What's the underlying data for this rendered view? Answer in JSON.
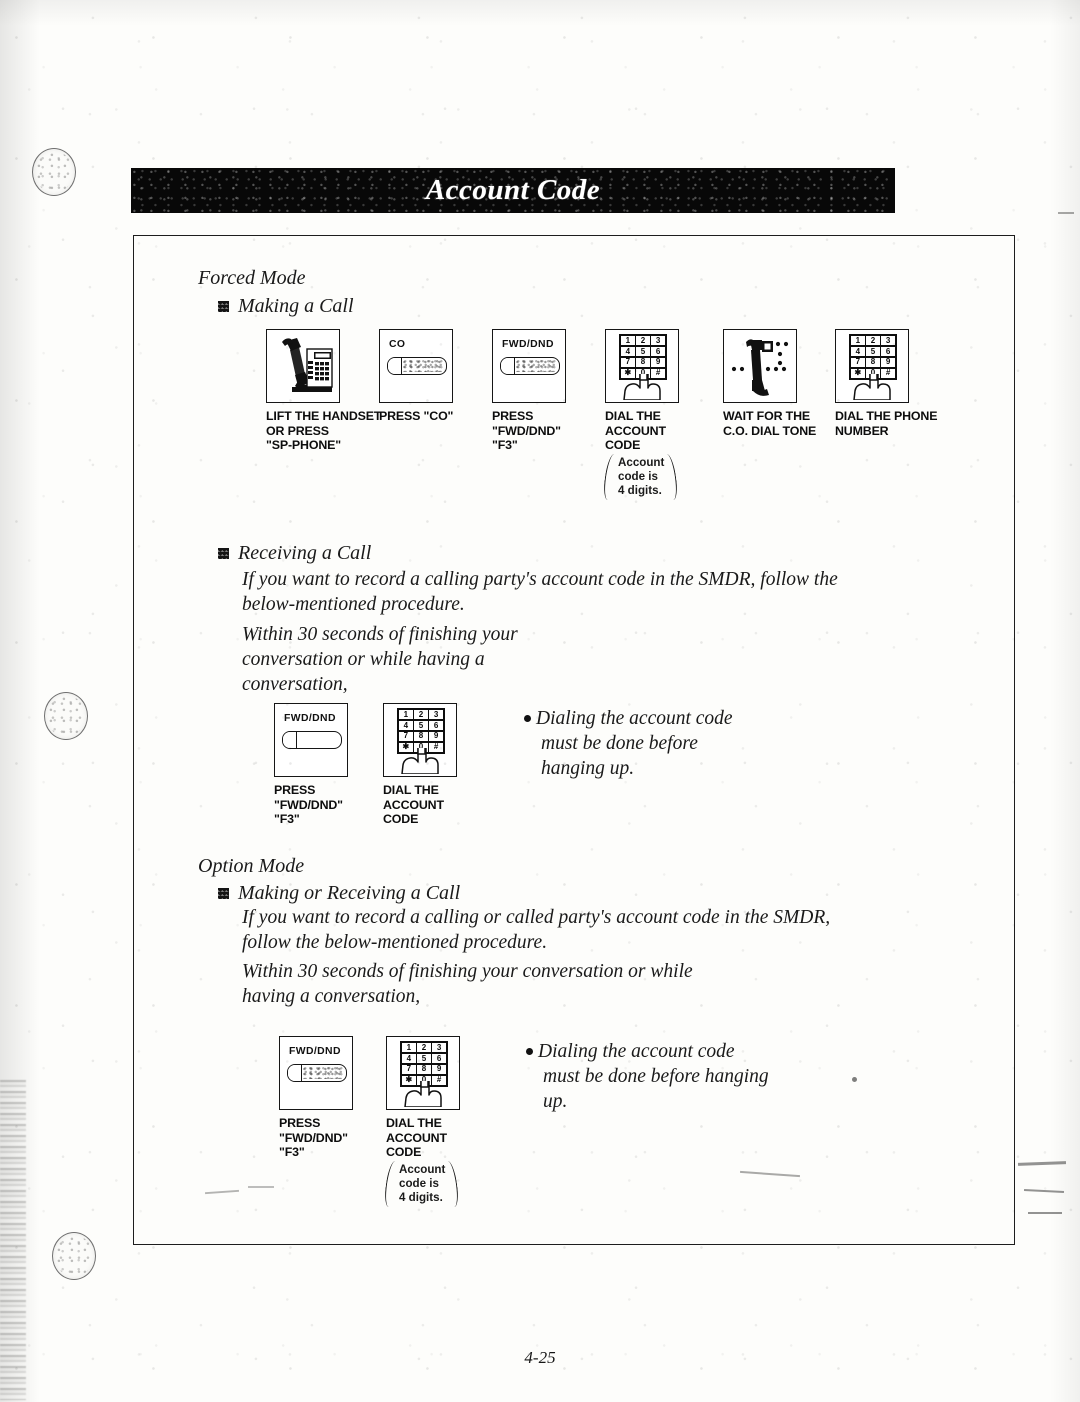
{
  "document": {
    "header_title": "Account Code",
    "page_number": "4-25"
  },
  "sections": [
    {
      "id": "forced-mode",
      "heading": "Forced Mode",
      "subsections": [
        {
          "id": "making-a-call",
          "bullet_heading": "Making a Call",
          "steps": [
            {
              "icon": "desk-phone-handset-lifted-icon",
              "caption": [
                "LIFT THE HANDSET",
                "OR PRESS",
                "\"SP-PHONE\""
              ],
              "box_label": "",
              "paren_note": []
            },
            {
              "icon": "co-button-icon",
              "box_label": "CO",
              "caption": [
                "PRESS \"CO\""
              ],
              "paren_note": []
            },
            {
              "icon": "fwd-dnd-button-icon",
              "box_label": "FWD/DND",
              "caption": [
                "PRESS",
                "\"FWD/DND\"",
                "\"F3\""
              ],
              "paren_note": []
            },
            {
              "icon": "keypad-dial-icon",
              "box_label": "",
              "caption": [
                "DIAL THE",
                "ACCOUNT",
                "CODE"
              ],
              "paren_note": [
                "Account",
                "code is",
                "4 digits."
              ]
            },
            {
              "icon": "handset-dial-tone-icon",
              "box_label": "",
              "caption": [
                "WAIT FOR THE",
                "C.O. DIAL TONE"
              ],
              "paren_note": []
            },
            {
              "icon": "keypad-dial-icon",
              "box_label": "",
              "caption": [
                "DIAL THE PHONE",
                "NUMBER"
              ],
              "paren_note": []
            }
          ]
        },
        {
          "id": "receiving-a-call",
          "bullet_heading": "Receiving a Call",
          "body": [
            "If you want to record a calling party's account code in the SMDR, follow the",
            "below-mentioned procedure."
          ],
          "timing": [
            "Within 30 seconds of finishing your",
            "conversation or while having a",
            "conversation,"
          ],
          "steps": [
            {
              "icon": "fwd-dnd-button-icon",
              "box_label": "FWD/DND",
              "caption": [
                "PRESS",
                "\"FWD/DND\"",
                "\"F3\""
              ],
              "paren_note": []
            },
            {
              "icon": "keypad-dial-icon",
              "box_label": "",
              "caption": [
                "DIAL THE",
                "ACCOUNT",
                "CODE"
              ],
              "paren_note": []
            }
          ],
          "note": [
            "Dialing the account code",
            "must be done before",
            "hanging up."
          ]
        }
      ]
    },
    {
      "id": "option-mode",
      "heading": "Option Mode",
      "subsections": [
        {
          "id": "making-or-receiving-a-call",
          "bullet_heading": "Making or Receiving a Call",
          "body": [
            "If you want to record a calling or called party's account code in the SMDR,",
            "follow the below-mentioned procedure."
          ],
          "timing": [
            "Within 30 seconds of finishing your conversation or while",
            "having a conversation,"
          ],
          "steps": [
            {
              "icon": "fwd-dnd-button-icon",
              "box_label": "FWD/DND",
              "caption": [
                "PRESS",
                "\"FWD/DND\"",
                "\"F3\""
              ],
              "paren_note": []
            },
            {
              "icon": "keypad-dial-icon",
              "box_label": "",
              "caption": [
                "DIAL THE",
                "ACCOUNT",
                "CODE"
              ],
              "paren_note": [
                "Account",
                "code is",
                "4 digits."
              ]
            }
          ],
          "note": [
            "Dialing the account code",
            "must be done before hanging",
            "up."
          ]
        }
      ]
    }
  ],
  "keypad": {
    "keys": [
      "1",
      "2",
      "3",
      "4",
      "5",
      "6",
      "7",
      "8",
      "9",
      "✱",
      "0",
      "#"
    ]
  },
  "colors": {
    "ink": "#141414",
    "paper": "#fdfdfb",
    "banner": "#080808",
    "banner_text": "#ffffff"
  }
}
